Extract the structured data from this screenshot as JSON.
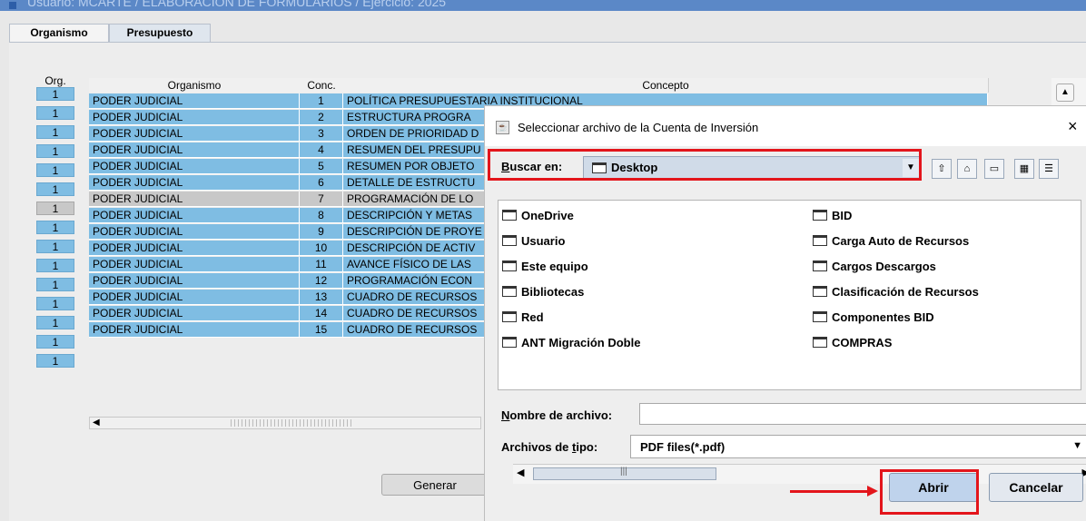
{
  "window": {
    "title": "Usuario: MCARTE / ELABORACIÓN DE FORMULARIOS / Ejercicio: 2025"
  },
  "tabs": [
    {
      "label": "Organismo"
    },
    {
      "label": "Presupuesto"
    }
  ],
  "grid": {
    "org_header": "Org.",
    "columns": [
      "Organismo",
      "Conc.",
      "Concepto"
    ],
    "rows": [
      {
        "org": "1",
        "organismo": "PODER JUDICIAL",
        "conc": "1",
        "concepto": "POLÍTICA PRESUPUESTARIA INSTITUCIONAL"
      },
      {
        "org": "1",
        "organismo": "PODER JUDICIAL",
        "conc": "2",
        "concepto": "ESTRUCTURA PROGRA"
      },
      {
        "org": "1",
        "organismo": "PODER JUDICIAL",
        "conc": "3",
        "concepto": "ORDEN DE PRIORIDAD D"
      },
      {
        "org": "1",
        "organismo": "PODER JUDICIAL",
        "conc": "4",
        "concepto": "RESUMEN DEL PRESUPU"
      },
      {
        "org": "1",
        "organismo": "PODER JUDICIAL",
        "conc": "5",
        "concepto": "RESUMEN POR OBJETO"
      },
      {
        "org": "1",
        "organismo": "PODER JUDICIAL",
        "conc": "6",
        "concepto": "DETALLE DE ESTRUCTU"
      },
      {
        "org": "1",
        "organismo": "PODER JUDICIAL",
        "conc": "7",
        "concepto": "PROGRAMACIÓN DE LO"
      },
      {
        "org": "1",
        "organismo": "PODER JUDICIAL",
        "conc": "8",
        "concepto": "DESCRIPCIÓN Y METAS"
      },
      {
        "org": "1",
        "organismo": "PODER JUDICIAL",
        "conc": "9",
        "concepto": "DESCRIPCIÓN DE PROYE"
      },
      {
        "org": "1",
        "organismo": "PODER JUDICIAL",
        "conc": "10",
        "concepto": "DESCRIPCIÓN DE ACTIV"
      },
      {
        "org": "1",
        "organismo": "PODER JUDICIAL",
        "conc": "11",
        "concepto": "AVANCE FÍSICO DE LAS"
      },
      {
        "org": "1",
        "organismo": "PODER JUDICIAL",
        "conc": "12",
        "concepto": "PROGRAMACIÓN ECON"
      },
      {
        "org": "1",
        "organismo": "PODER JUDICIAL",
        "conc": "13",
        "concepto": "CUADRO DE RECURSOS"
      },
      {
        "org": "1",
        "organismo": "PODER JUDICIAL",
        "conc": "14",
        "concepto": "CUADRO DE RECURSOS"
      },
      {
        "org": "1",
        "organismo": "PODER JUDICIAL",
        "conc": "15",
        "concepto": "CUADRO DE RECURSOS"
      }
    ],
    "selected_row": 6
  },
  "generar_label": "Generar",
  "dialog": {
    "title": "Seleccionar archivo de la Cuenta de Inversión",
    "close_glyph": "×",
    "look_in_prefix": "B",
    "look_in_rest": "uscar en:",
    "look_in_value": "Desktop",
    "files_left": [
      "OneDrive",
      "Usuario",
      "Este equipo",
      "Bibliotecas",
      "Red",
      "ANT Migración Doble"
    ],
    "files_right": [
      "BID",
      "Carga Auto de Recursos",
      "Cargos Descargos",
      "Clasificación de Recursos",
      "Componentes BID",
      "COMPRAS"
    ],
    "filename_prefix": "N",
    "filename_rest": "ombre de archivo:",
    "filename_value": "",
    "filetype_pre": "Archivos de ",
    "filetype_u": "t",
    "filetype_post": "ipo:",
    "filetype_value": "PDF files(*.pdf)",
    "open_label": "Abrir",
    "cancel_label": "Cancelar"
  },
  "colors": {
    "row_blue": "#7fbde3",
    "row_selected": "#c8c8c8",
    "highlight_red": "#e3151b"
  }
}
